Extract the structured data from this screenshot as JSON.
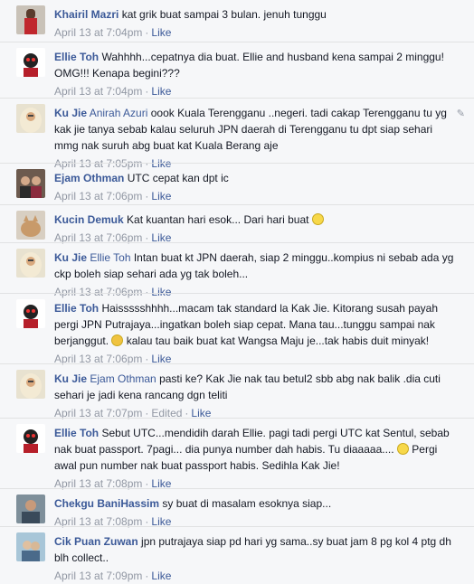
{
  "comments": [
    {
      "author": "Khairil Mazri",
      "mention": "",
      "text": "kat grik buat sampai 3 bulan. jenuh tunggu",
      "time": "April 13 at 7:04pm",
      "edited": "",
      "like": "Like"
    },
    {
      "author": "Ellie Toh",
      "mention": "",
      "text": "Wahhhh...cepatnya dia buat. Ellie and husband kena sampai 2 minggu! OMG!!! Kenapa begini???",
      "time": "April 13 at 7:04pm",
      "edited": "",
      "like": "Like"
    },
    {
      "author": "Ku Jie",
      "mention": "Anirah Azuri",
      "text": "oook Kuala Terengganu ..negeri. tadi cakap Terengganu tu yg kak jie tanya sebab kalau seluruh JPN daerah di Terengganu tu dpt siap sehari mmg nak suruh abg buat kat Kuala Berang aje",
      "time": "April 13 at 7:05pm",
      "edited": "",
      "like": "Like"
    },
    {
      "author": "Ejam Othman",
      "mention": "",
      "text": "UTC cepat kan dpt ic",
      "time": "April 13 at 7:06pm",
      "edited": "",
      "like": "Like"
    },
    {
      "author": "Kucin Demuk",
      "mention": "",
      "text": "Kat kuantan hari esok... Dari hari buat",
      "time": "April 13 at 7:06pm",
      "edited": "",
      "like": "Like"
    },
    {
      "author": "Ku Jie",
      "mention": "Ellie Toh",
      "text": "Intan buat kt JPN daerah, siap 2 minggu..kompius ni sebab ada yg ckp boleh siap sehari ada yg tak boleh...",
      "time": "April 13 at 7:06pm",
      "edited": "",
      "like": "Like"
    },
    {
      "author": "Ellie Toh",
      "mention": "",
      "text": "Haissssshhhh...macam tak standard la Kak Jie. Kitorang susah payah pergi JPN Putrajaya...ingatkan boleh siap cepat. Mana tau...tunggu sampai nak berjanggut.",
      "text2": "kalau tau baik buat kat Wangsa Maju je...tak habis duit minyak!",
      "time": "April 13 at 7:06pm",
      "edited": "",
      "like": "Like"
    },
    {
      "author": "Ku Jie",
      "mention": "Ejam Othman",
      "text": "pasti ke? Kak Jie nak tau betul2 sbb abg nak balik .dia cuti sehari je jadi kena rancang dgn teliti",
      "time": "April 13 at 7:07pm",
      "edited": "Edited",
      "like": "Like"
    },
    {
      "author": "Ellie Toh",
      "mention": "",
      "text": "Sebut UTC...mendidih darah Ellie. pagi tadi pergi UTC kat Sentul, sebab nak buat passport. 7pagi... dia punya number dah habis. Tu diaaaaa....",
      "text2": "Pergi awal pun number nak buat passport habis. Sedihla Kak Jie!",
      "time": "April 13 at 7:08pm",
      "edited": "",
      "like": "Like"
    },
    {
      "author": "Chekgu BaniHassim",
      "mention": "",
      "text": "sy buat di masalam esoknya siap...",
      "time": "April 13 at 7:08pm",
      "edited": "",
      "like": "Like"
    },
    {
      "author": "Cik Puan Zuwan",
      "mention": "",
      "text": "jpn putrajaya siap pd hari yg sama..sy buat jam 8 pg kol 4 ptg dh blh collect..",
      "time": "April 13 at 7:09pm",
      "edited": "",
      "like": "Like"
    }
  ],
  "colors": {
    "link": "#3b5998",
    "meta": "#9197a3",
    "background": "#f6f7f9"
  }
}
